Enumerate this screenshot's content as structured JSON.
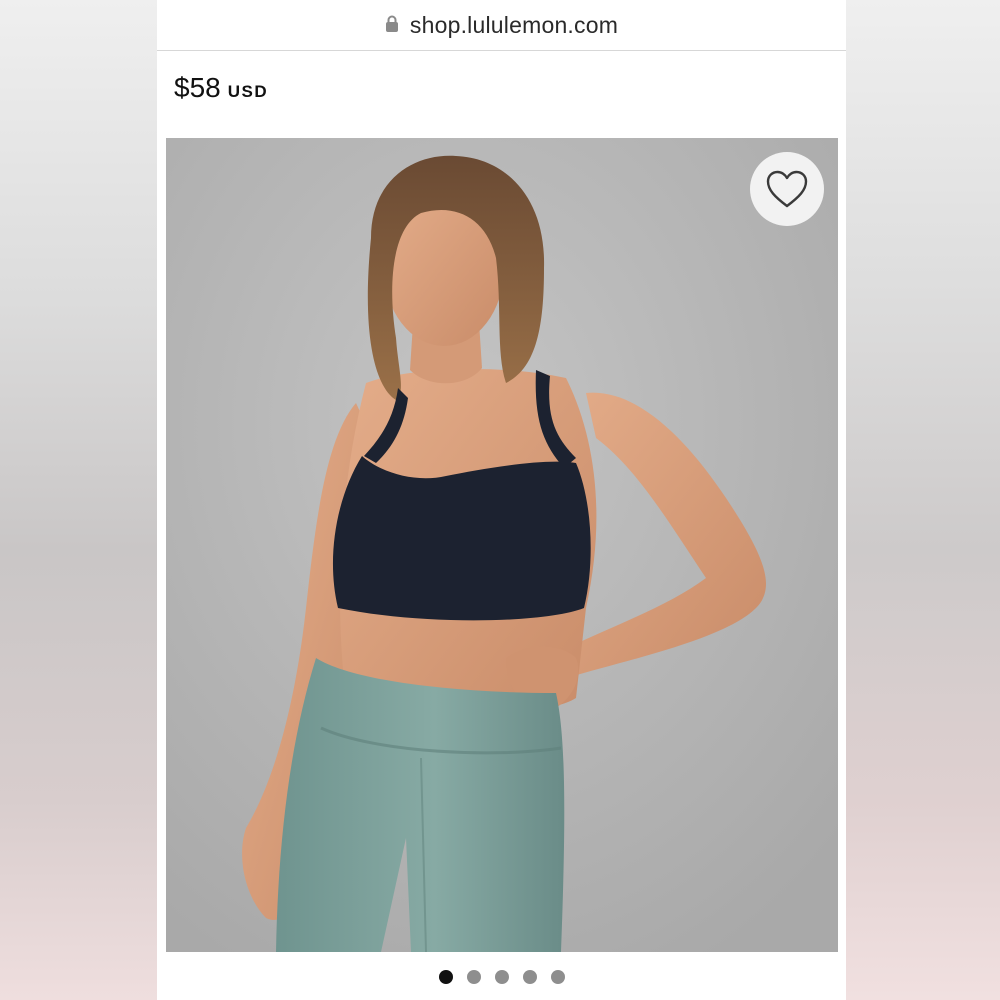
{
  "browser": {
    "url": "shop.lululemon.com",
    "lock_icon": "lock-icon"
  },
  "product": {
    "price": "$58",
    "currency": "USD"
  },
  "gallery": {
    "wishlist_icon": "heart-outline-icon",
    "slide_count": 5,
    "active_slide": 1
  },
  "colors": {
    "background_gray": "#b8b8b8",
    "bra_navy": "#1c2230",
    "leggings_sage": "#7fa29d"
  }
}
